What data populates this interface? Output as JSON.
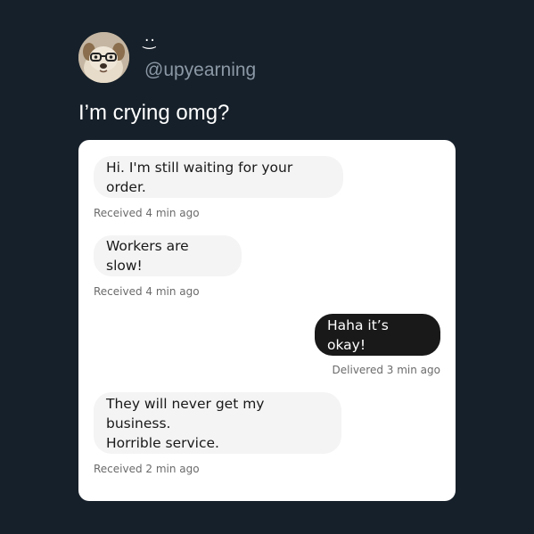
{
  "tweet": {
    "display_name": "·͜·",
    "handle": "@upyearning",
    "text": "I’m crying omg?",
    "avatar_icon": "dog-with-glasses-avatar"
  },
  "messages": [
    {
      "direction": "received",
      "text": "Hi. I'm still waiting for your order.",
      "status": "Received 4 min ago"
    },
    {
      "direction": "received",
      "text": "Workers are slow!",
      "status": "Received 4 min ago"
    },
    {
      "direction": "sent",
      "text": "Haha it’s okay!",
      "status": "Delivered 3 min ago"
    },
    {
      "direction": "received",
      "text": "They will never get my business.\nHorrible service.",
      "status": "Received 2 min ago"
    }
  ],
  "colors": {
    "background": "#16202a",
    "card": "#ffffff",
    "received_bubble": "#f4f4f4",
    "sent_bubble": "#191919",
    "handle": "#8b98a5"
  }
}
